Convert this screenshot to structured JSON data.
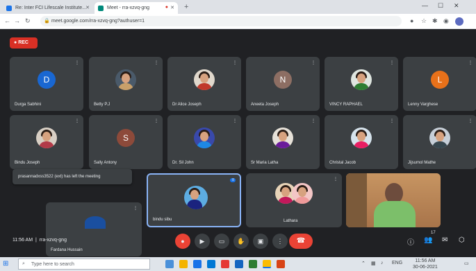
{
  "browser": {
    "tabs": [
      {
        "label": "Re: Inter FCI Lifescale Institute...",
        "active": false,
        "fav_color": "#1a73e8"
      },
      {
        "label": "Meet - rra-xzvq-gng",
        "active": true,
        "fav_color": "#00897b"
      }
    ],
    "address": "meet.google.com/rra-xzvq-gng?authuser=1",
    "lock_icon": "lock-icon"
  },
  "meet": {
    "rec_label": "REC",
    "participants_row1": [
      {
        "name": "Durga Sabhini",
        "kind": "initial",
        "initial": "D",
        "color": "#1967d2"
      },
      {
        "name": "Betty P.J",
        "kind": "photo",
        "bg": "#4a5a6a",
        "body": "#c9a06a"
      },
      {
        "name": "Dr Alice Joseph",
        "kind": "photo",
        "bg": "#e0d8cc",
        "body": "#c0392b"
      },
      {
        "name": "Aneeta Joseph",
        "kind": "initial",
        "initial": "N",
        "color": "#8d6e63"
      },
      {
        "name": "VINCY RAPHAEL",
        "kind": "photo",
        "bg": "#dfe6e0",
        "body": "#2e7d32"
      },
      {
        "name": "Lenny Varghese",
        "kind": "initial",
        "initial": "L",
        "color": "#e8711a"
      }
    ],
    "participants_row2": [
      {
        "name": "Bindu Joseph",
        "kind": "photo",
        "bg": "#d8cfc4",
        "body": "#b23a48"
      },
      {
        "name": "Sally Antony",
        "kind": "initial",
        "initial": "S",
        "color": "#8d4a3a"
      },
      {
        "name": "Dr. Sil John",
        "kind": "photo",
        "bg": "#3949ab",
        "body": "#1e88e5"
      },
      {
        "name": "Sr Maria Latha",
        "kind": "photo",
        "bg": "#e6e1d8",
        "body": "#6a1b9a"
      },
      {
        "name": "Christal Jacob",
        "kind": "photo",
        "bg": "#d6e3ec",
        "body": "#e91e63"
      },
      {
        "name": "Jijsumol Mathe",
        "kind": "photo",
        "bg": "#c7cfd8",
        "body": "#37474f"
      }
    ],
    "participants_row3": [
      {
        "name": "Fardana Hussain",
        "kind": "icon"
      },
      {
        "name": "bindu sibu",
        "kind": "photo",
        "bg": "#5dade2",
        "body": "#1a237e",
        "pinned": true
      },
      {
        "name": "Lathara",
        "kind": "pair"
      },
      {
        "name": "",
        "kind": "video"
      }
    ],
    "toast": "prasannadxss3522 (ext) has left the meeting",
    "time": "11:56 AM",
    "meeting_code": "rra-xzvq-gng",
    "controls": [
      "mic-icon",
      "camera-icon",
      "captions-icon",
      "raise-hand-icon",
      "present-icon",
      "more-icon"
    ],
    "end_call": "end-call-icon",
    "right_controls": [
      "info-icon",
      "people-icon",
      "chat-icon",
      "activities-icon"
    ],
    "participant_count": "17"
  },
  "taskbar": {
    "search_placeholder": "Type here to search",
    "time": "11:56 AM",
    "date": "30-06-2021",
    "lang": "ENG"
  }
}
